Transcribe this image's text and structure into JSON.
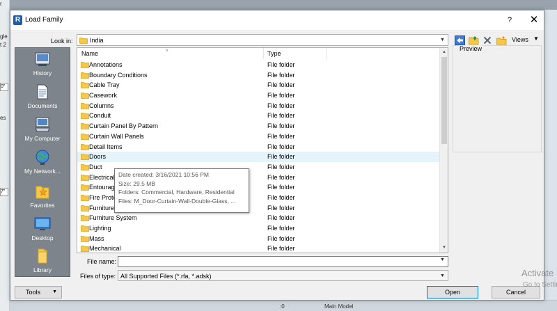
{
  "background": {
    "frag_top": "r",
    "frag_a": "gle",
    "frag_b": "t 2",
    "box_a": "0\"",
    "frag_c": "es",
    "box_b": "7\"",
    "bottom_zero": ":0",
    "bottom_model": "Main Model",
    "activate": "Activate",
    "activate_sub": "Go to Settings"
  },
  "dialog": {
    "title": "Load Family",
    "app_icon_letter": "R",
    "help_label": "?",
    "close_label": "✕",
    "accent_color": "#0078d7"
  },
  "look_in": {
    "label": "Look in:",
    "value": "India"
  },
  "toolbar": {
    "views_label": "Views"
  },
  "places": [
    {
      "label": "History",
      "icon": "history-icon"
    },
    {
      "label": "Documents",
      "icon": "documents-icon"
    },
    {
      "label": "My Computer",
      "icon": "computer-icon"
    },
    {
      "label": "My Network...",
      "icon": "network-icon"
    },
    {
      "label": "Favorites",
      "icon": "favorites-icon"
    },
    {
      "label": "Desktop",
      "icon": "desktop-icon"
    },
    {
      "label": "Library",
      "icon": "library-icon"
    }
  ],
  "file_list": {
    "columns": {
      "name": "Name",
      "type": "Type"
    },
    "rows": [
      {
        "name": "Annotations",
        "type": "File folder"
      },
      {
        "name": "Boundary Conditions",
        "type": "File folder"
      },
      {
        "name": "Cable Tray",
        "type": "File folder"
      },
      {
        "name": "Casework",
        "type": "File folder"
      },
      {
        "name": "Columns",
        "type": "File folder"
      },
      {
        "name": "Conduit",
        "type": "File folder"
      },
      {
        "name": "Curtain Panel By Pattern",
        "type": "File folder"
      },
      {
        "name": "Curtain Wall Panels",
        "type": "File folder"
      },
      {
        "name": "Detail Items",
        "type": "File folder"
      },
      {
        "name": "Doors",
        "type": "File folder"
      },
      {
        "name": "Duct",
        "type": "File folder"
      },
      {
        "name": "Electrical",
        "type": "File folder"
      },
      {
        "name": "Entourage",
        "type": "File folder"
      },
      {
        "name": "Fire Protection",
        "type": "File folder"
      },
      {
        "name": "Furniture",
        "type": "File folder"
      },
      {
        "name": "Furniture System",
        "type": "File folder"
      },
      {
        "name": "Lighting",
        "type": "File folder"
      },
      {
        "name": "Mass",
        "type": "File folder"
      },
      {
        "name": "Mechanical",
        "type": "File folder"
      }
    ],
    "hovered_index": 9
  },
  "tooltip": {
    "date_created": "Date created: 3/16/2021 10:56 PM",
    "size": "Size: 29.5 MB",
    "folders": "Folders: Commercial, Hardware, Residential",
    "files": "Files: M_Door-Curtain-Wall-Double-Glass, ..."
  },
  "preview": {
    "label": "Preview"
  },
  "file_name": {
    "label": "File name:",
    "value": ""
  },
  "files_of_type": {
    "label": "Files of type:",
    "value": "All Supported Files  (*.rfa, *.adsk)"
  },
  "buttons": {
    "tools": "Tools",
    "open": "Open",
    "cancel": "Cancel"
  }
}
